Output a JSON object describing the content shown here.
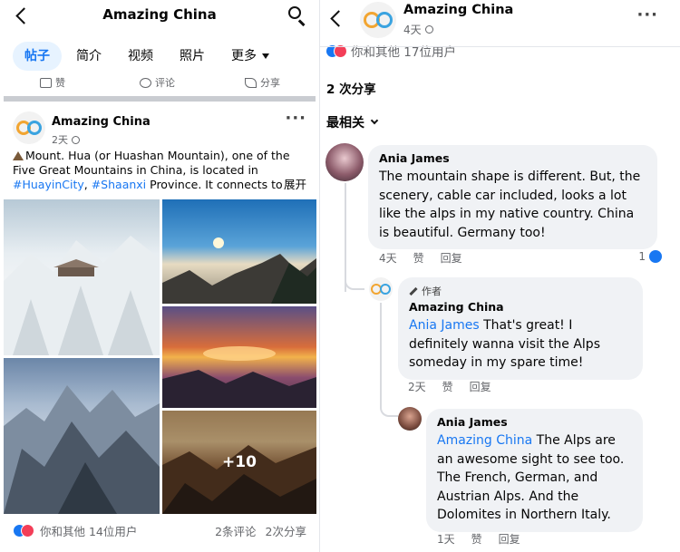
{
  "left": {
    "header": {
      "title": "Amazing China"
    },
    "tabs": [
      {
        "label": "帖子",
        "active": true
      },
      {
        "label": "简介"
      },
      {
        "label": "视频"
      },
      {
        "label": "照片"
      }
    ],
    "more_label": "更多",
    "actions": {
      "like": "赞",
      "comment": "评论",
      "share": "分享"
    },
    "post": {
      "author": "Amazing China",
      "time": "2天",
      "text_prefix": "Mount. Hua (or Huashan Mountain), one of the Five Great Mountains in China, is located in ",
      "hashtag1": "#HuayinCity",
      "text_sep": ", ",
      "hashtag2": "#Shaanxi",
      "text_suffix": " Province. It connects to...",
      "see_more": "展开",
      "more_photos": "+10",
      "reactions_text": "你和其他 14位用户",
      "comments_count": "2条评论",
      "shares_count": "2次分享"
    }
  },
  "right": {
    "header": {
      "title": "Amazing China",
      "time": "4天"
    },
    "reactions_text": "你和其他 17位用户",
    "shares": "2 次分享",
    "sort_label": "最相关",
    "comments": [
      {
        "name": "Ania James",
        "text": "The mountain shape is different. But, the scenery, cable car included, looks a lot like the alps in my native country. China is beautiful. Germany too!",
        "time": "4天",
        "like": "赞",
        "reply": "回复",
        "likes": "1"
      },
      {
        "author_badge": "作者",
        "name": "Amazing China",
        "mention": "Ania James",
        "text": " That's great! I definitely wanna visit the Alps someday in my spare time!",
        "time": "2天",
        "like": "赞",
        "reply": "回复"
      },
      {
        "name": "Ania James",
        "mention": "Amazing China",
        "text": " The Alps are an awesome sight to see too. The French, German, and Austrian Alps. And the Dolomites in Northern Italy.",
        "time": "1天",
        "like": "赞",
        "reply": "回复"
      }
    ]
  },
  "colors": {
    "accent": "#1877f2",
    "love": "#f33e58",
    "bubble": "#f0f2f5",
    "meta": "#65676b"
  }
}
